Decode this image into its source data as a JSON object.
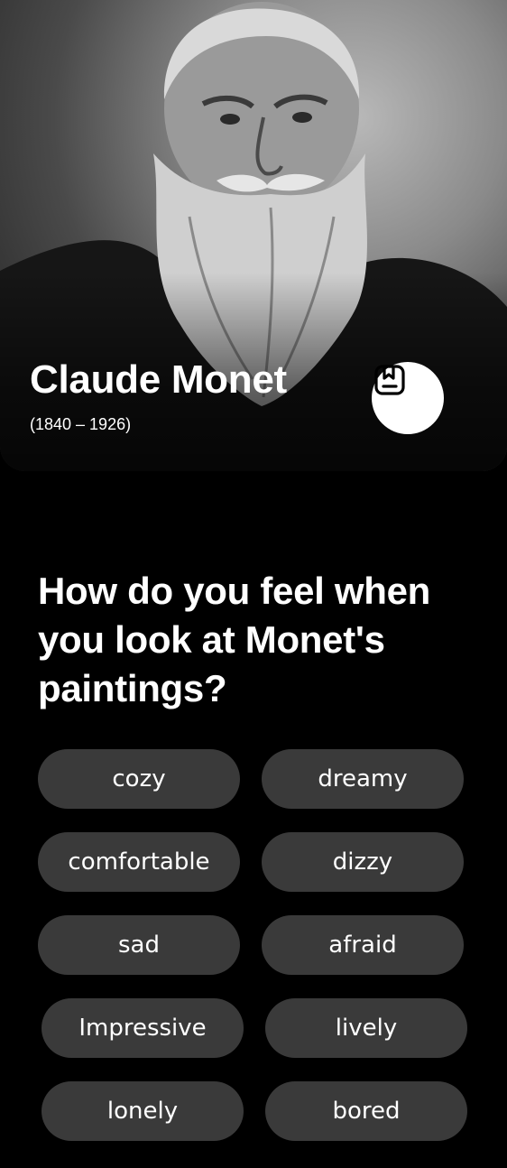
{
  "artist": {
    "name": "Claude Monet",
    "years": "(1840 – 1926)"
  },
  "question": "How do you feel when you look at Monet's paintings?",
  "options": [
    {
      "label": "cozy"
    },
    {
      "label": "dreamy"
    },
    {
      "label": "comfortable"
    },
    {
      "label": "dizzy"
    },
    {
      "label": "sad"
    },
    {
      "label": "afraid"
    },
    {
      "label": "Impressive"
    },
    {
      "label": "lively"
    },
    {
      "label": "lonely"
    },
    {
      "label": "bored"
    }
  ],
  "icons": {
    "bookmark": "bookmark-icon"
  },
  "colors": {
    "background": "#000000",
    "chip": "#3a3a3a",
    "text": "#ffffff"
  }
}
